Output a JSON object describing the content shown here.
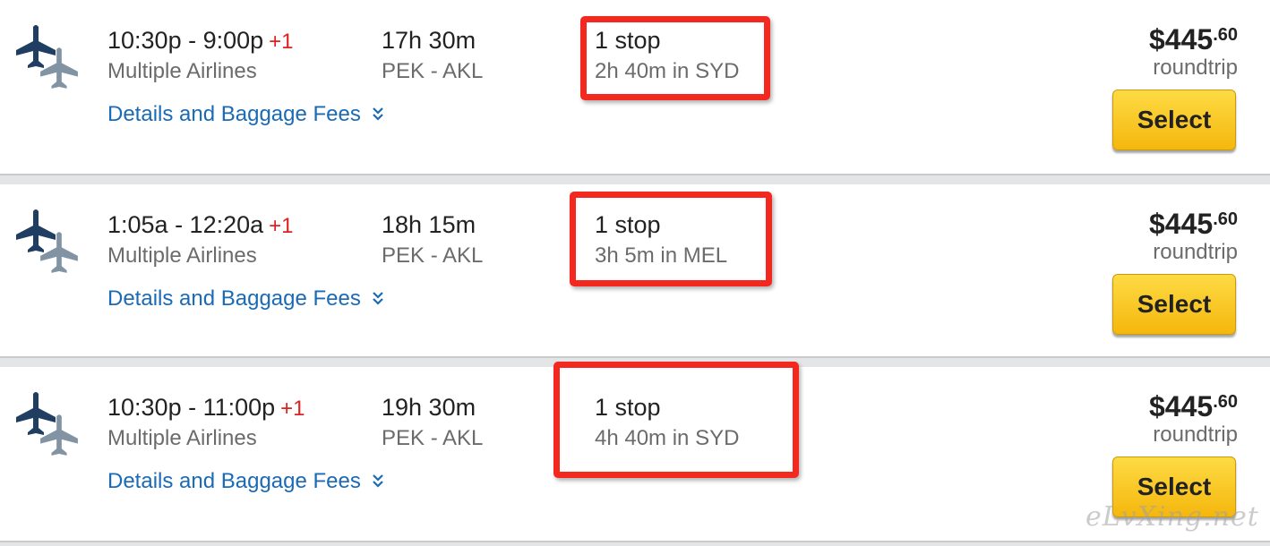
{
  "flights": [
    {
      "times": "10:30p - 9:00p",
      "day_offset": "+1",
      "airline": "Multiple Airlines",
      "details_link": "Details and Baggage Fees",
      "duration": "17h 30m",
      "route": "PEK - AKL",
      "stops": "1 stop",
      "layover": "2h 40m in SYD",
      "price_dollars": "$445",
      "price_cents": ".60",
      "price_type": "roundtrip",
      "select_label": "Select"
    },
    {
      "times": "1:05a - 12:20a",
      "day_offset": "+1",
      "airline": "Multiple Airlines",
      "details_link": "Details and Baggage Fees",
      "duration": "18h 15m",
      "route": "PEK - AKL",
      "stops": "1 stop",
      "layover": "3h 5m in MEL",
      "price_dollars": "$445",
      "price_cents": ".60",
      "price_type": "roundtrip",
      "select_label": "Select"
    },
    {
      "times": "10:30p - 11:00p",
      "day_offset": "+1",
      "airline": "Multiple Airlines",
      "details_link": "Details and Baggage Fees",
      "duration": "19h 30m",
      "route": "PEK - AKL",
      "stops": "1 stop",
      "layover": "4h 40m in SYD",
      "price_dollars": "$445",
      "price_cents": ".60",
      "price_type": "roundtrip",
      "select_label": "Select"
    }
  ],
  "icons": {
    "airline": "multiple-airplanes-icon",
    "expand": "chevron-double-down-icon"
  },
  "colors": {
    "link": "#1a6ab5",
    "day_offset": "#dd2222",
    "highlight_box": "#f3281e",
    "select_button": "#f8c620"
  },
  "watermark": "eLvXing.net"
}
